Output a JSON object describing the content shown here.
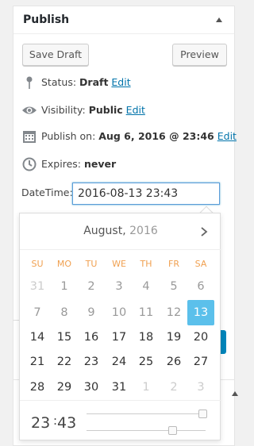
{
  "publish_box": {
    "title": "Publish",
    "save_draft_label": "Save Draft",
    "preview_label": "Preview",
    "status": {
      "label": "Status:",
      "value": "Draft",
      "edit": "Edit"
    },
    "visibility": {
      "label": "Visibility:",
      "value": "Public",
      "edit": "Edit"
    },
    "publish_on": {
      "label": "Publish on:",
      "value": "Aug 6, 2016 @ 23:46",
      "edit": "Edit"
    },
    "expires": {
      "label": "Expires:",
      "value": "never"
    },
    "datetime": {
      "label": "DateTime:",
      "value": "2016-08-13 23:43"
    }
  },
  "datepicker": {
    "month": "August,",
    "year": "2016",
    "weekdays": [
      "SU",
      "MO",
      "TU",
      "WE",
      "TH",
      "FR",
      "SA"
    ],
    "weeks": [
      [
        "31",
        "1",
        "2",
        "3",
        "4",
        "5",
        "6"
      ],
      [
        "7",
        "8",
        "9",
        "10",
        "11",
        "12",
        "13"
      ],
      [
        "14",
        "15",
        "16",
        "17",
        "18",
        "19",
        "20"
      ],
      [
        "21",
        "22",
        "23",
        "24",
        "25",
        "26",
        "27"
      ],
      [
        "28",
        "29",
        "30",
        "31",
        "1",
        "2",
        "3"
      ]
    ],
    "selected_day": "13",
    "time": {
      "hours": "23",
      "separator": ":",
      "minutes": "43"
    }
  },
  "colors": {
    "accent": "#5bc0eb",
    "link": "#0073aa",
    "weekday": "#f0a050",
    "primary_button": "#0085ba"
  },
  "icons": [
    "pin-icon",
    "eye-icon",
    "calendar-icon",
    "clock-icon",
    "chevron-right-icon",
    "collapse-arrow-icon"
  ]
}
